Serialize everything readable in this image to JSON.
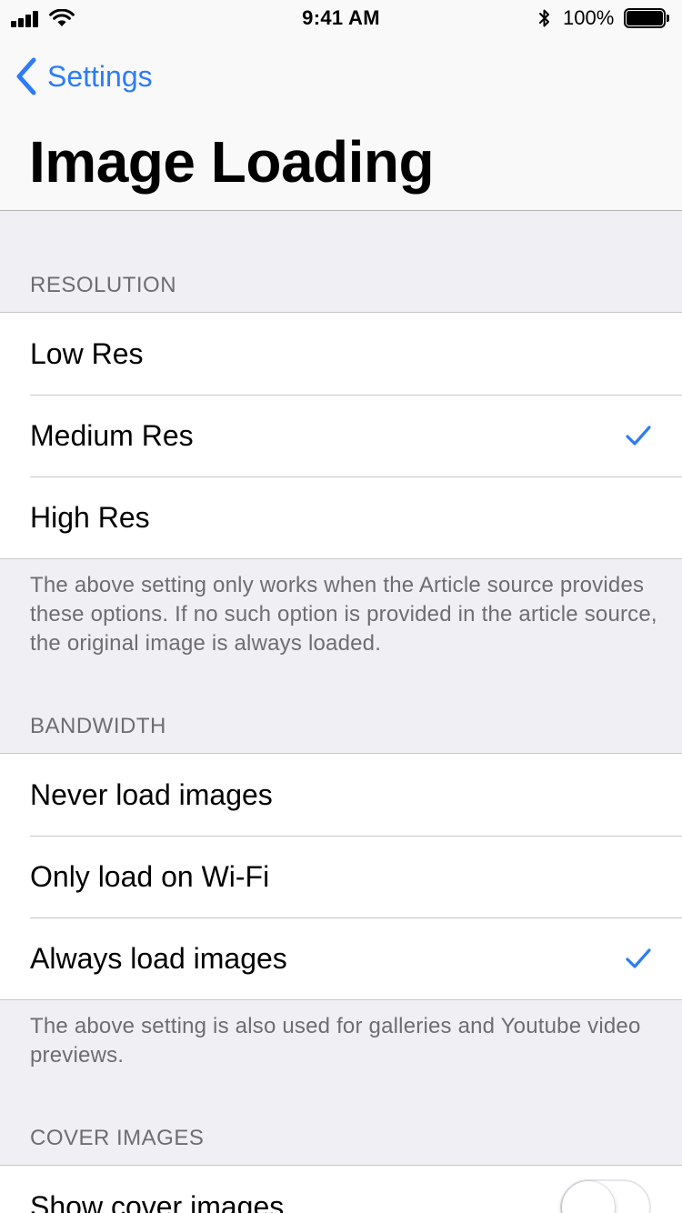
{
  "status_bar": {
    "time": "9:41 AM",
    "battery_percent": "100%",
    "icons": [
      "signal-icon",
      "wifi-icon",
      "bluetooth-icon",
      "battery-icon"
    ]
  },
  "nav": {
    "back_label": "Settings",
    "title": "Image Loading"
  },
  "colors": {
    "accent": "#2d7cf6",
    "background": "#efeff4",
    "secondary_text": "#6d6d72",
    "separator": "#c8c7cc"
  },
  "sections": {
    "resolution": {
      "header": "RESOLUTION",
      "items": [
        {
          "label": "Low Res",
          "selected": false
        },
        {
          "label": "Medium Res",
          "selected": true
        },
        {
          "label": "High Res",
          "selected": false
        }
      ],
      "footer": "The above setting only works when the Article source provides these options. If no such option is provided in the article source, the original image is always loaded."
    },
    "bandwidth": {
      "header": "BANDWIDTH",
      "items": [
        {
          "label": "Never load images",
          "selected": false
        },
        {
          "label": "Only load on Wi-Fi",
          "selected": false
        },
        {
          "label": "Always load images",
          "selected": true
        }
      ],
      "footer": "The above setting is also used for galleries and Youtube video previews."
    },
    "cover_images": {
      "header": "COVER IMAGES",
      "items": [
        {
          "label": "Show cover images",
          "toggle": false
        }
      ]
    }
  }
}
